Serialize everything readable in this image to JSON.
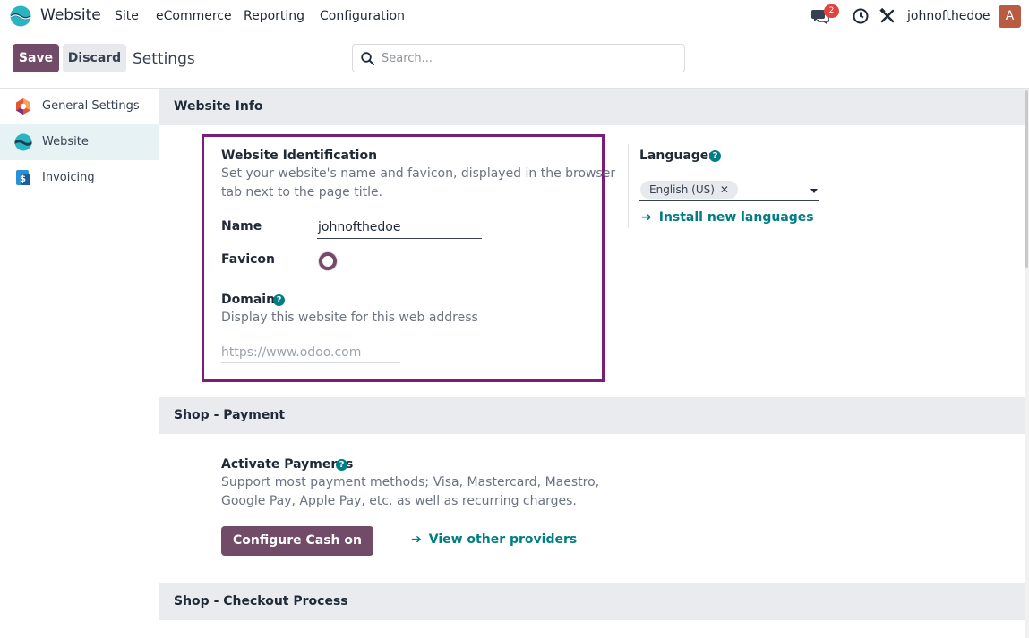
{
  "navbar": {
    "app_name": "Website",
    "menu": [
      "Site",
      "eCommerce",
      "Reporting",
      "Configuration"
    ],
    "messages_badge": "2",
    "username": "johnofthedoe",
    "avatar_letter": "A"
  },
  "control_panel": {
    "save_label": "Save",
    "discard_label": "Discard",
    "title": "Settings",
    "search_placeholder": "Search..."
  },
  "sidebar": {
    "items": [
      {
        "label": "General Settings",
        "icon": "odoo-settings-icon"
      },
      {
        "label": "Website",
        "icon": "website-app-icon",
        "active": true
      },
      {
        "label": "Invoicing",
        "icon": "invoicing-app-icon"
      }
    ]
  },
  "sections": {
    "website_info": {
      "title": "Website Info",
      "identification": {
        "title": "Website Identification",
        "description_line1": "Set your website's name and favicon, displayed in the browser",
        "description_line2": "tab next to the page title.",
        "name_label": "Name",
        "name_value": "johnofthedoe",
        "favicon_label": "Favicon"
      },
      "domain": {
        "title": "Domain",
        "description": "Display this website for this web address",
        "placeholder": "https://www.odoo.com"
      },
      "languages": {
        "title": "Languages",
        "selected": "English (US)",
        "remove_glyph": "✕",
        "install_link": "Install new languages"
      }
    },
    "shop_payment": {
      "title": "Shop - Payment",
      "activate": {
        "title": "Activate Payments",
        "description_line1": "Support most payment methods; Visa, Mastercard, Maestro,",
        "description_line2": "Google Pay, Apple Pay, etc. as well as recurring charges.",
        "configure_button": "Configure Cash on Delivery",
        "other_providers_link": "View other providers"
      }
    },
    "shop_checkout": {
      "title": "Shop - Checkout Process"
    }
  },
  "colors": {
    "primary": "#714b67",
    "link": "#017e84",
    "highlight_border": "#7b1e7a",
    "badge": "#e0443f"
  }
}
